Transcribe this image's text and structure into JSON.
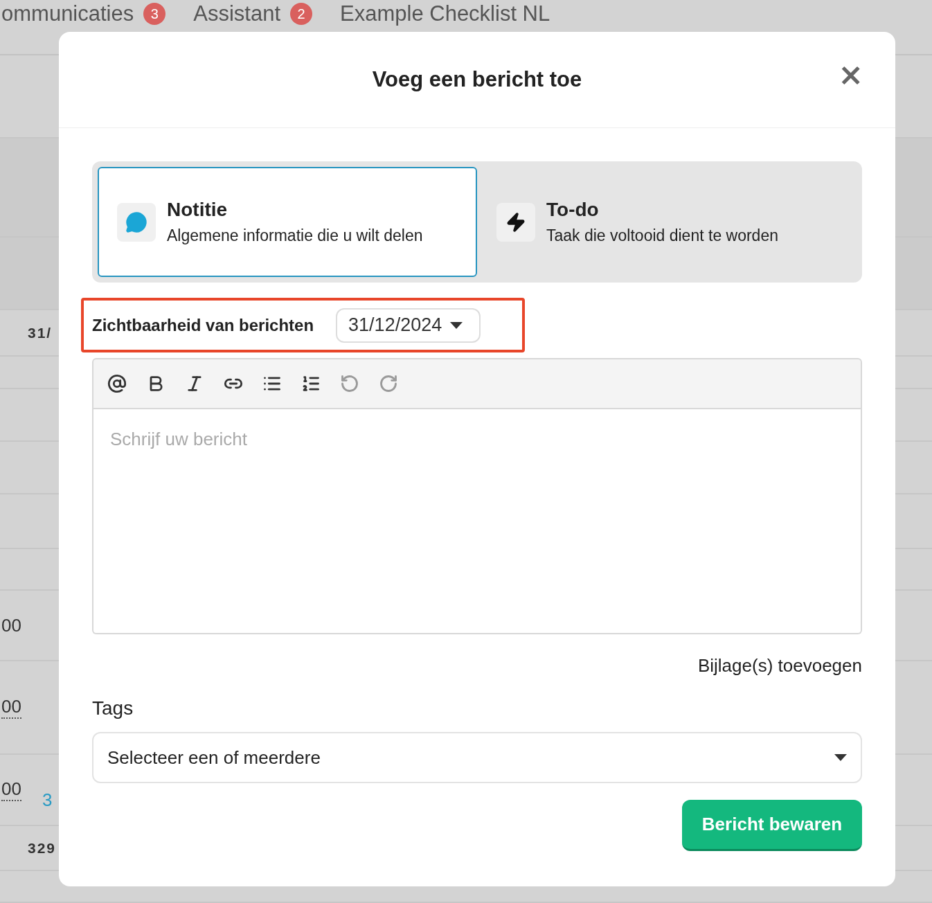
{
  "background": {
    "tabs": [
      {
        "label": "ommunicaties",
        "badge": "3"
      },
      {
        "label": "Assistant",
        "badge": "2"
      },
      {
        "label": "Example Checklist NL"
      }
    ],
    "cells": [
      {
        "text": "31/",
        "kind": "bold"
      },
      {
        "text": "00",
        "kind": "plain"
      },
      {
        "text": "00",
        "kind": "dotted"
      },
      {
        "text": "00",
        "kind": "dotted"
      },
      {
        "text": "3",
        "kind": "link"
      },
      {
        "text": "329",
        "kind": "bold"
      }
    ]
  },
  "dialog": {
    "title": "Voeg een bericht toe",
    "close": "×",
    "types": [
      {
        "kind": "note",
        "title": "Notitie",
        "description": "Algemene informatie die u wilt delen",
        "selected": true
      },
      {
        "kind": "todo",
        "title": "To-do",
        "description": "Taak die voltooid dient te worden",
        "selected": false
      }
    ],
    "visibility": {
      "label": "Zichtbaarheid van berichten",
      "value": "31/12/2024",
      "highlighted": true
    },
    "toolbar": [
      {
        "kind": "mention",
        "disabled": false
      },
      {
        "kind": "bold",
        "disabled": false
      },
      {
        "kind": "italic",
        "disabled": false
      },
      {
        "kind": "link",
        "disabled": false
      },
      {
        "kind": "bullets",
        "disabled": false
      },
      {
        "kind": "numbers",
        "disabled": false
      },
      {
        "kind": "undo",
        "disabled": true
      },
      {
        "kind": "redo",
        "disabled": true
      }
    ],
    "editor": {
      "placeholder": "Schrijf uw bericht"
    },
    "attach_link": "Bijlage(s) toevoegen",
    "tags": {
      "label": "Tags",
      "placeholder": "Selecteer een of meerdere"
    },
    "submit": "Bericht bewaren"
  }
}
